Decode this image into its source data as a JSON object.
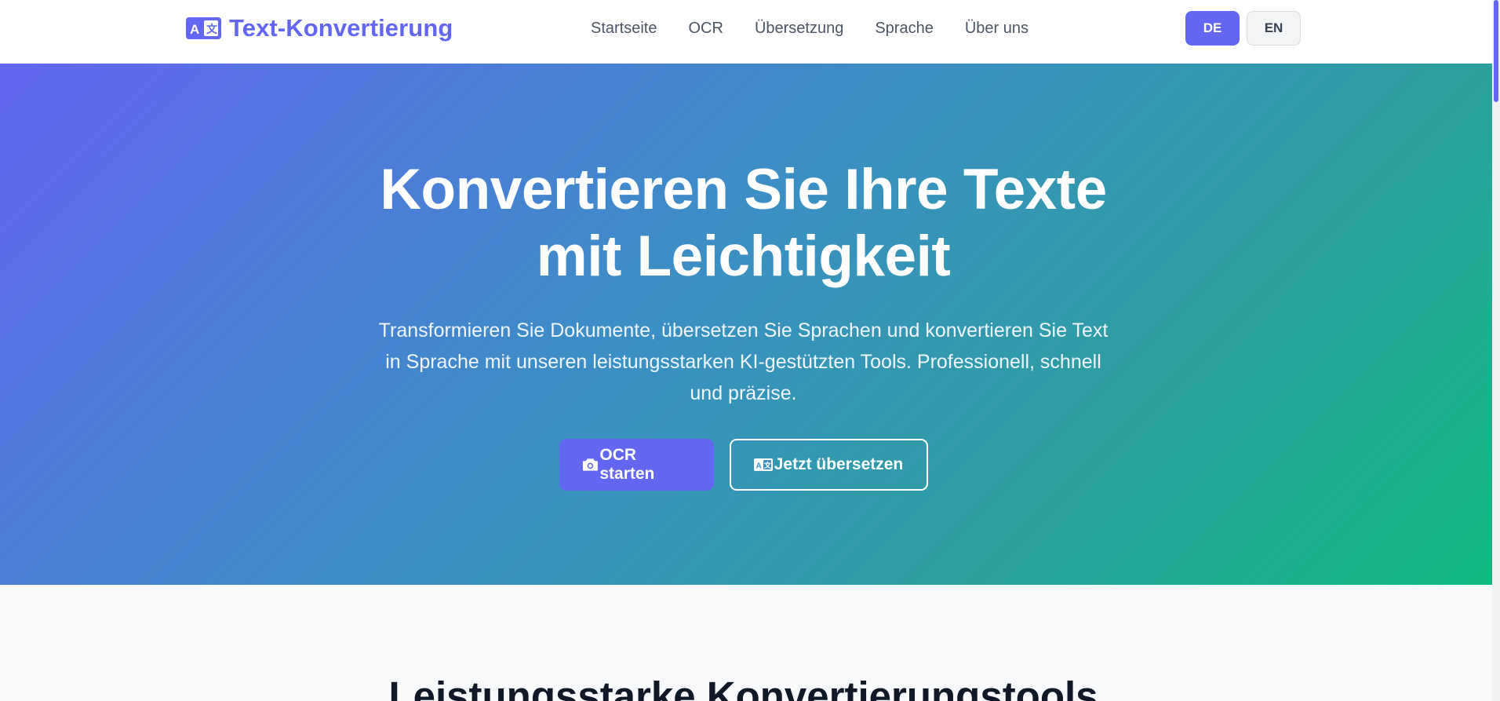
{
  "brand": {
    "name": "Text-Konvertierung",
    "icon": "translate-icon",
    "color": "#6366f1"
  },
  "nav": {
    "items": [
      {
        "label": "Startseite"
      },
      {
        "label": "OCR"
      },
      {
        "label": "Übersetzung"
      },
      {
        "label": "Sprache"
      },
      {
        "label": "Über uns"
      }
    ]
  },
  "language": {
    "options": [
      {
        "label": "DE",
        "active": true
      },
      {
        "label": "EN",
        "active": false
      }
    ]
  },
  "hero": {
    "title_line1": "Konvertieren Sie Ihre Texte",
    "title_line2": "mit Leichtigkeit",
    "subtitle_line1": "Transformieren Sie Dokumente, übersetzen Sie Sprachen und konvertieren Sie Text",
    "subtitle_line2": "in Sprache mit unseren leistungsstarken KI-gestützten Tools. Professionell, schnell",
    "subtitle_line3": "und präzise.",
    "primary_button": {
      "label": "OCR starten",
      "icon": "camera-icon"
    },
    "secondary_button": {
      "label": "Jetzt übersetzen",
      "icon": "translate-icon"
    },
    "gradient_start": "#6366f1",
    "gradient_end": "#10b981"
  },
  "features": {
    "title": "Leistungsstarke Konvertierungstools"
  }
}
